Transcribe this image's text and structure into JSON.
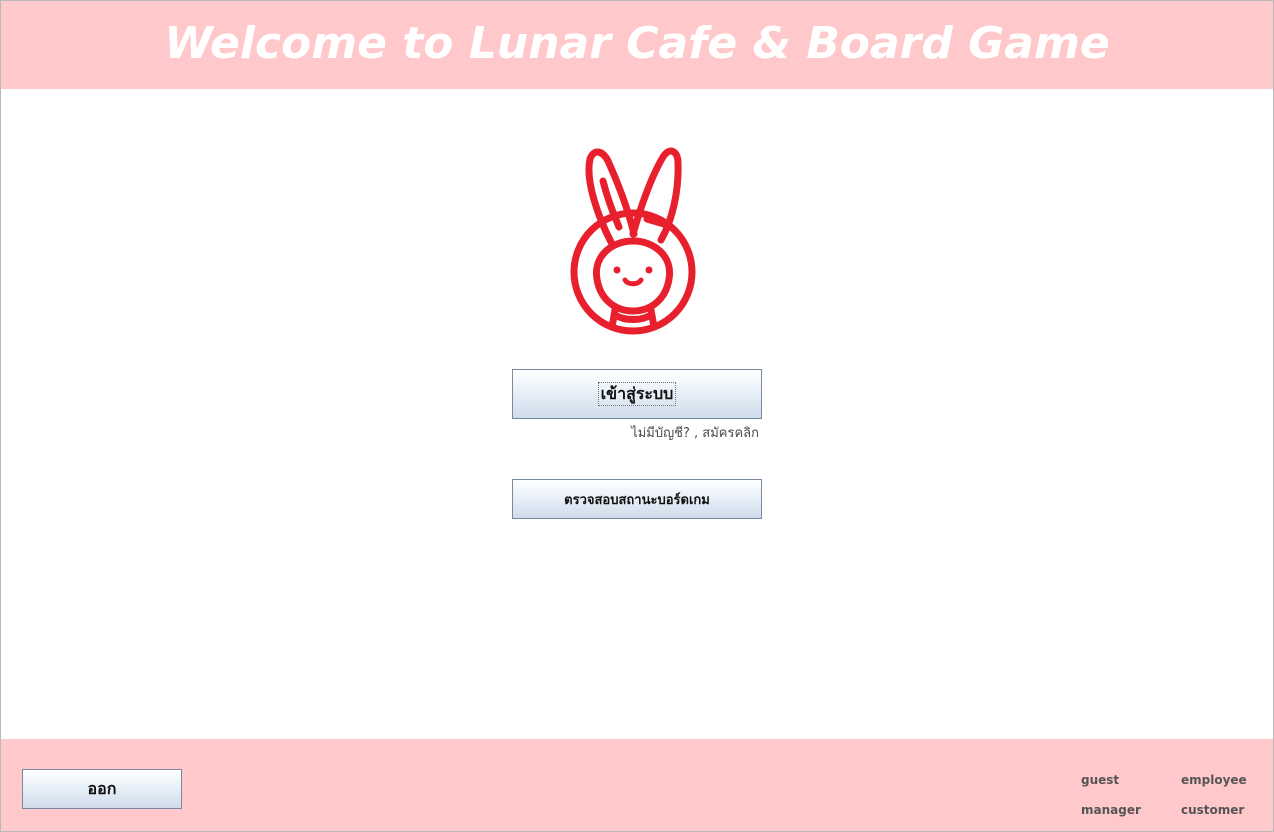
{
  "header": {
    "title": "Welcome to Lunar Cafe & Board Game"
  },
  "logo": {
    "icon": "rabbit-logo-icon",
    "color": "#e8202e"
  },
  "main": {
    "login_label": "เข้าสู่ระบบ",
    "register_link": "ไม่มีบัญชี? , สมัครคลิก",
    "check_status_label": "ตรวจสอบสถานะบอร์ดเกม"
  },
  "footer": {
    "exit_label": "ออก",
    "roles": {
      "guest": "guest",
      "employee": "employee",
      "manager": "manager",
      "customer": "customer"
    }
  },
  "colors": {
    "header_bg": "#ffc8cb",
    "footer_bg": "#ffc8cb",
    "title_text": "#ffffff",
    "accent": "#e8202e"
  }
}
